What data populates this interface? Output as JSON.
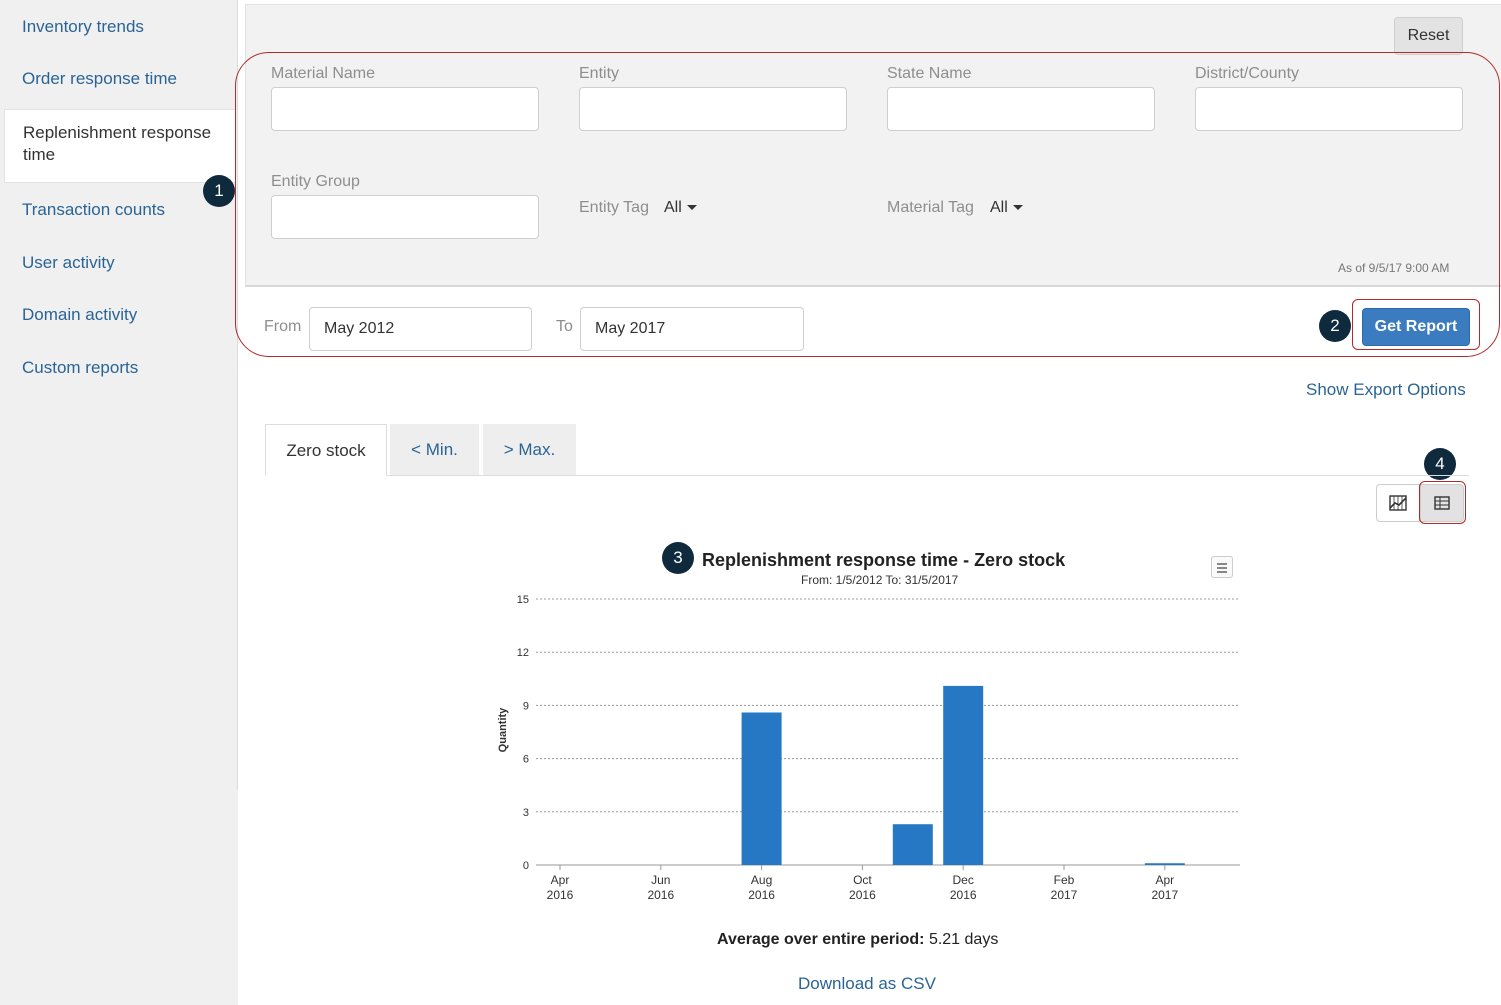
{
  "sidebar": {
    "items": [
      {
        "label": "Inventory trends"
      },
      {
        "label": "Order response time"
      },
      {
        "label": "Replenishment response time",
        "active": true
      },
      {
        "label": "Transaction counts"
      },
      {
        "label": "User activity"
      },
      {
        "label": "Domain activity"
      },
      {
        "label": "Custom reports"
      }
    ]
  },
  "filters": {
    "reset_label": "Reset",
    "material_name_label": "Material Name",
    "material_name_value": "",
    "entity_label": "Entity",
    "entity_value": "",
    "state_name_label": "State Name",
    "state_name_value": "",
    "district_label": "District/County",
    "district_value": "",
    "entity_group_label": "Entity Group",
    "entity_group_value": "",
    "entity_tag_label": "Entity Tag",
    "entity_tag_value": "All",
    "material_tag_label": "Material Tag",
    "material_tag_value": "All",
    "as_of": "As of 9/5/17 9:00 AM"
  },
  "range": {
    "from_label": "From",
    "from_value": "May 2012",
    "to_label": "To",
    "to_value": "May 2017",
    "get_report_label": "Get Report"
  },
  "callouts": {
    "c1": "1",
    "c2": "2",
    "c3": "3",
    "c4": "4"
  },
  "export_options_label": "Show Export Options",
  "tabs": [
    {
      "label": "Zero stock",
      "active": true
    },
    {
      "label": "< Min."
    },
    {
      "label": "> Max."
    }
  ],
  "chart": {
    "title": "Replenishment response time - Zero stock",
    "subtitle": "From: 1/5/2012 To: 31/5/2017",
    "average_label": "Average over entire period:",
    "average_value": "5.21 days",
    "download_label": "Download as CSV"
  },
  "chart_data": {
    "type": "bar",
    "title": "Replenishment response time - Zero stock",
    "subtitle": "From: 1/5/2012 To: 31/5/2017",
    "ylabel": "Quantity",
    "xlabel": "",
    "ylim": [
      0,
      15
    ],
    "yticks": [
      0,
      3,
      6,
      9,
      12,
      15
    ],
    "grid": true,
    "months": [
      "Apr 2016",
      "May 2016",
      "Jun 2016",
      "Jul 2016",
      "Aug 2016",
      "Sep 2016",
      "Oct 2016",
      "Nov 2016",
      "Dec 2016",
      "Jan 2017",
      "Feb 2017",
      "Mar 2017",
      "Apr 2017"
    ],
    "values": [
      0,
      0,
      0,
      0,
      8.6,
      0,
      0,
      2.3,
      10.1,
      0,
      0,
      0,
      0.1
    ],
    "tick_labels": [
      {
        "month": "Apr",
        "year": "2016"
      },
      {
        "month": "Jun",
        "year": "2016"
      },
      {
        "month": "Aug",
        "year": "2016"
      },
      {
        "month": "Oct",
        "year": "2016"
      },
      {
        "month": "Dec",
        "year": "2016"
      },
      {
        "month": "Feb",
        "year": "2017"
      },
      {
        "month": "Apr",
        "year": "2017"
      }
    ],
    "bar_color": "#2677c4"
  }
}
